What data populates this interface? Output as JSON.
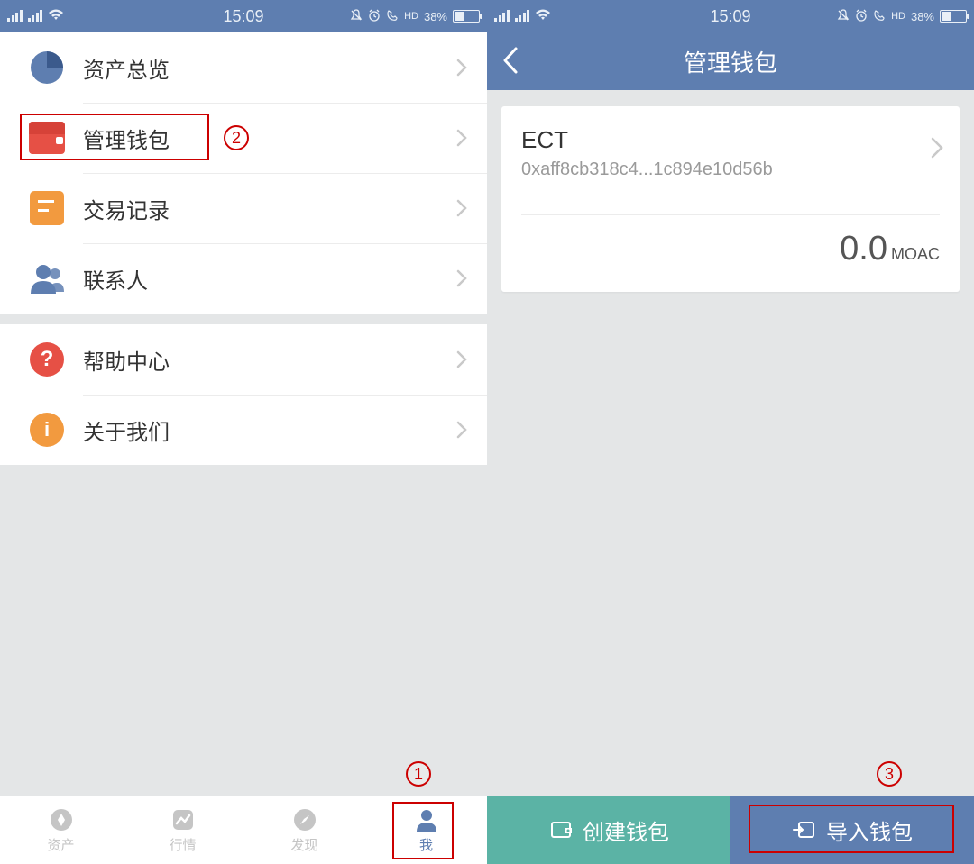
{
  "status": {
    "time": "15:09",
    "battery_percent": "38%",
    "hd": "HD"
  },
  "left": {
    "menu": {
      "overview": "资产总览",
      "manage_wallet": "管理钱包",
      "transactions": "交易记录",
      "contacts": "联系人",
      "help": "帮助中心",
      "about": "关于我们"
    },
    "icons": {
      "help_glyph": "?",
      "about_glyph": "i"
    },
    "tabs": {
      "assets": "资产",
      "market": "行情",
      "discover": "发现",
      "me": "我"
    },
    "annotations": {
      "one": "1",
      "two": "2"
    }
  },
  "right": {
    "header_title": "管理钱包",
    "wallet": {
      "name": "ECT",
      "address": "0xaff8cb318c4...1c894e10d56b",
      "balance_value": "0.0",
      "balance_unit": "MOAC"
    },
    "buttons": {
      "create": "创建钱包",
      "import": "导入钱包"
    },
    "annotations": {
      "three": "3"
    }
  }
}
